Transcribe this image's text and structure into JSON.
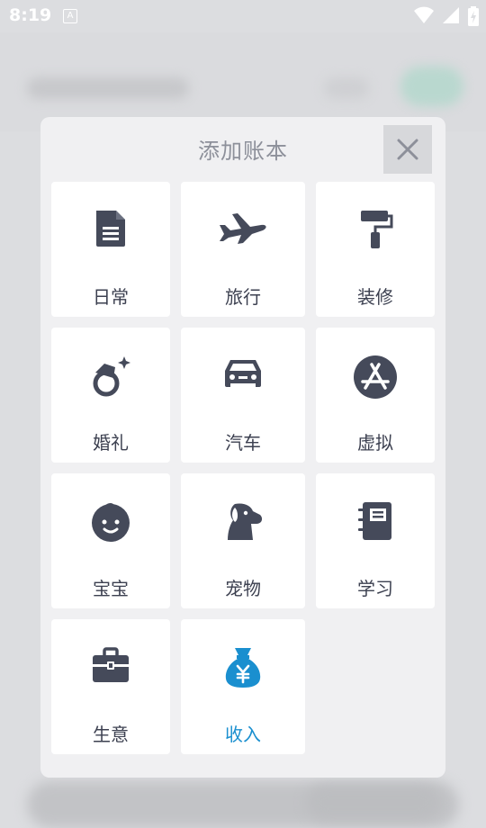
{
  "status_bar": {
    "time": "8:19",
    "notification_icon": "A",
    "icons": [
      "wifi-icon",
      "signal-icon",
      "battery-charging-icon"
    ]
  },
  "dialog": {
    "title": "添加账本",
    "close_icon": "close-icon",
    "accent_color": "#1a8fcf",
    "icon_color": "#454a5a",
    "items": [
      {
        "label": "日常",
        "icon": "document-icon"
      },
      {
        "label": "旅行",
        "icon": "airplane-icon"
      },
      {
        "label": "装修",
        "icon": "paint-roller-icon"
      },
      {
        "label": "婚礼",
        "icon": "ring-icon"
      },
      {
        "label": "汽车",
        "icon": "car-icon"
      },
      {
        "label": "虚拟",
        "icon": "app-store-icon"
      },
      {
        "label": "宝宝",
        "icon": "baby-face-icon"
      },
      {
        "label": "宠物",
        "icon": "dog-icon"
      },
      {
        "label": "学习",
        "icon": "notebook-icon"
      },
      {
        "label": "生意",
        "icon": "briefcase-icon"
      },
      {
        "label": "收入",
        "icon": "money-bag-icon"
      }
    ]
  }
}
